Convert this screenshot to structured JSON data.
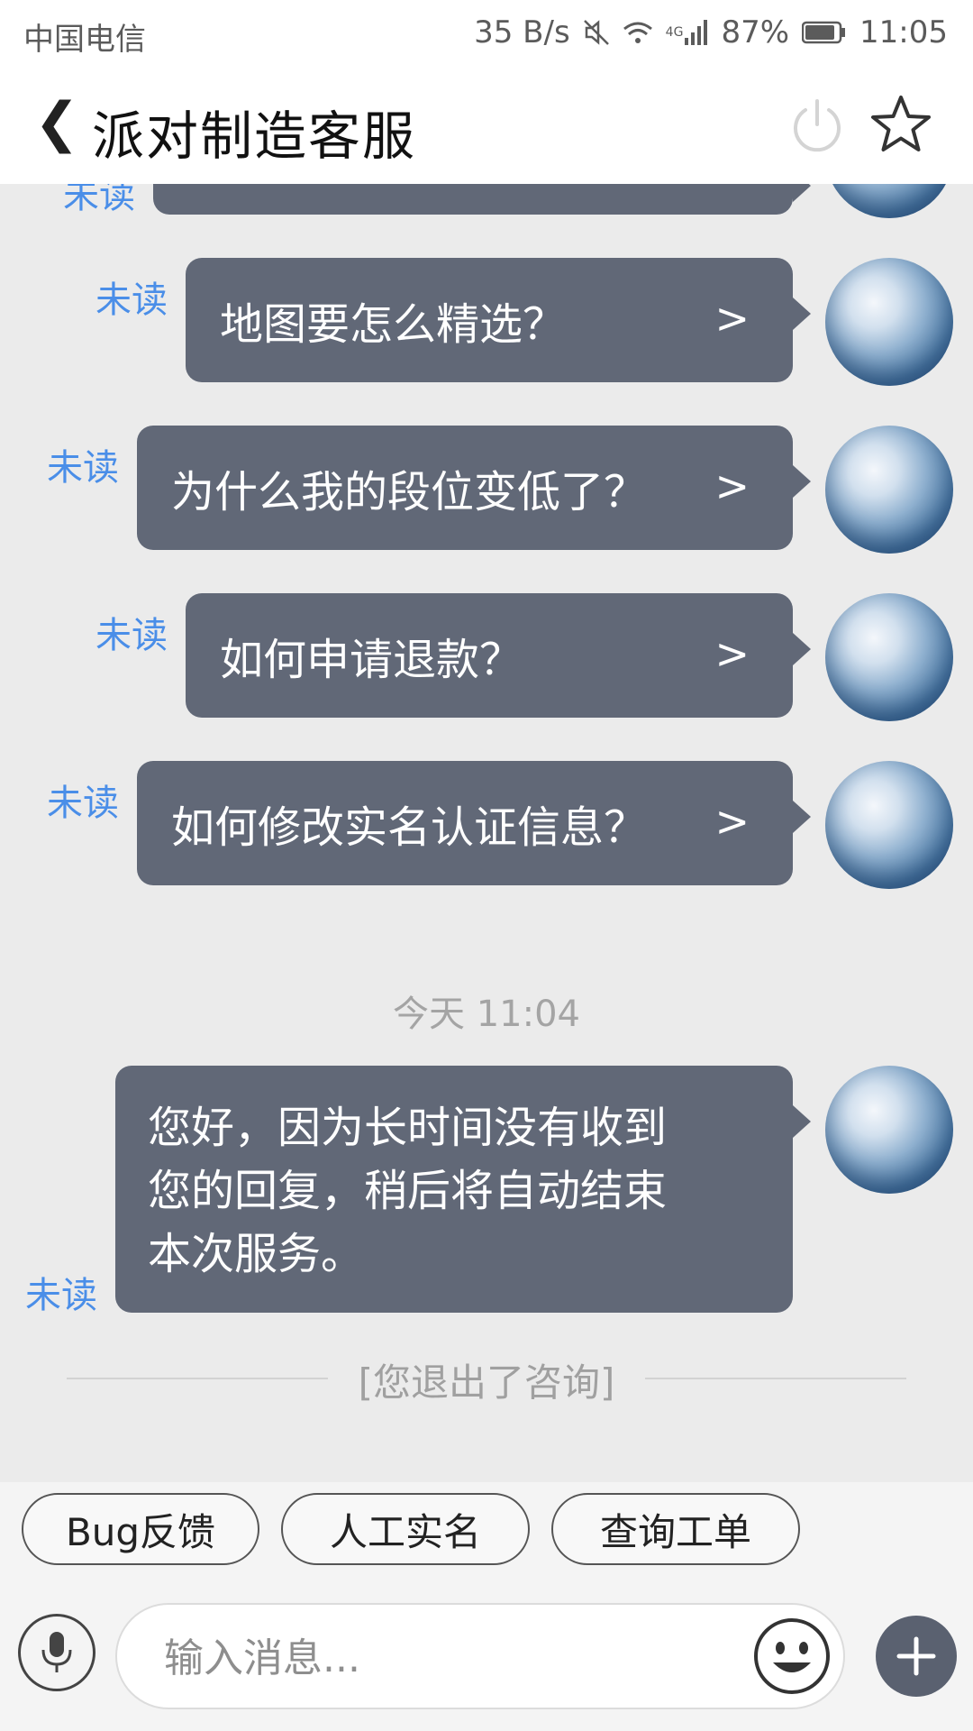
{
  "status_bar": {
    "carrier": "中国电信",
    "net_speed": "35 B/s",
    "network_type": "4G",
    "battery": "87%",
    "time": "11:05"
  },
  "header": {
    "back_symbol": "❮",
    "title": "派对制造客服"
  },
  "chat": {
    "partial_top": {
      "unread": "未读"
    },
    "questions": [
      {
        "text": "地图要怎么精选？",
        "arrow": ">",
        "unread": "未读"
      },
      {
        "text": "为什么我的段位变低了？",
        "arrow": ">",
        "unread": "未读"
      },
      {
        "text": "如何申请退款？",
        "arrow": ">",
        "unread": "未读"
      },
      {
        "text": "如何修改实名认证信息？",
        "arrow": ">",
        "unread": "未读"
      }
    ],
    "timestamp": "今天 11:04",
    "system_message": {
      "lines": [
        "您好，因为长时间没有收到",
        "您的回复，稍后将自动结束",
        "本次服务。"
      ],
      "unread": "未读"
    },
    "exit_notice": "[您退出了咨询]"
  },
  "quick_replies": [
    "Bug反馈",
    "人工实名",
    "查询工单"
  ],
  "input_bar": {
    "placeholder": "输入消息..."
  },
  "colors": {
    "bubble": "#616877",
    "unread": "#4a8ee8",
    "background": "#ebebeb"
  }
}
